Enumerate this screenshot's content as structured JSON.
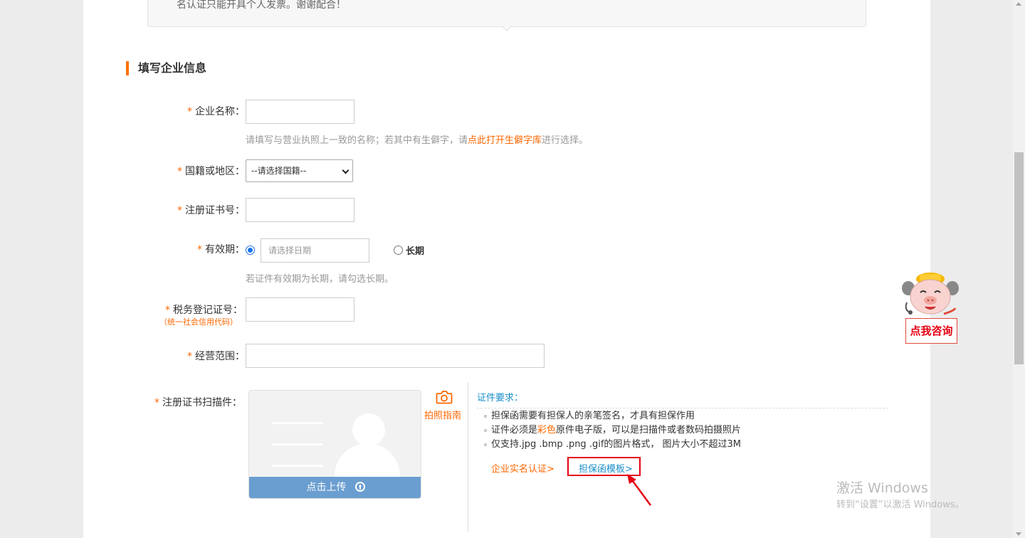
{
  "notice": {
    "text": "名认证只能开具个人发票。谢谢配合！"
  },
  "section": {
    "title": "填写企业信息"
  },
  "form": {
    "required_mark": "*",
    "company_name": {
      "label": "企业名称：",
      "value": "",
      "hint_before": "请填写与营业执照上一致的名称；若其中有生僻字，请",
      "hint_link": "点此打开生僻字库",
      "hint_after": "进行选择。"
    },
    "nationality": {
      "label": "国籍或地区：",
      "selected": "--请选择国籍--"
    },
    "reg_cert_no": {
      "label": "注册证书号：",
      "value": ""
    },
    "validity": {
      "label": "有效期：",
      "date_placeholder": "请选择日期",
      "long_term_label": "长期",
      "hint": "若证件有效期为长期，请勾选长期。",
      "selected": "date"
    },
    "tax_no": {
      "label": "税务登记证号：",
      "sublabel": "（统一社会信用代码）",
      "value": ""
    },
    "business_scope": {
      "label": "经营范围：",
      "value": ""
    },
    "scan": {
      "label": "注册证书扫描件：",
      "upload_button": "点击上传",
      "photo_guide": "拍照指南"
    }
  },
  "requirements": {
    "title": "证件要求：",
    "item1": "担保函需要有担保人的亲笔签名，才具有担保作用",
    "item2_before": "证件必须是",
    "item2_highlight": "彩色",
    "item2_after": "原件电子版，可以是扫描件或者数码拍摄照片",
    "item3": "仅支持.jpg .bmp .png .gif的图片格式， 图片大小不超过3M",
    "link_realname": "企业实名认证>",
    "link_template": "担保函模板>"
  },
  "consult": {
    "label": "点我咨询"
  },
  "watermark": {
    "line1": "激活 Windows",
    "line2": "转到“设置”以激活 Windows。"
  },
  "colors": {
    "accent": "#ff6600",
    "link_blue": "#1a8fc9",
    "highlight_red": "#e60012",
    "upload_blue": "#6a9ed0"
  }
}
